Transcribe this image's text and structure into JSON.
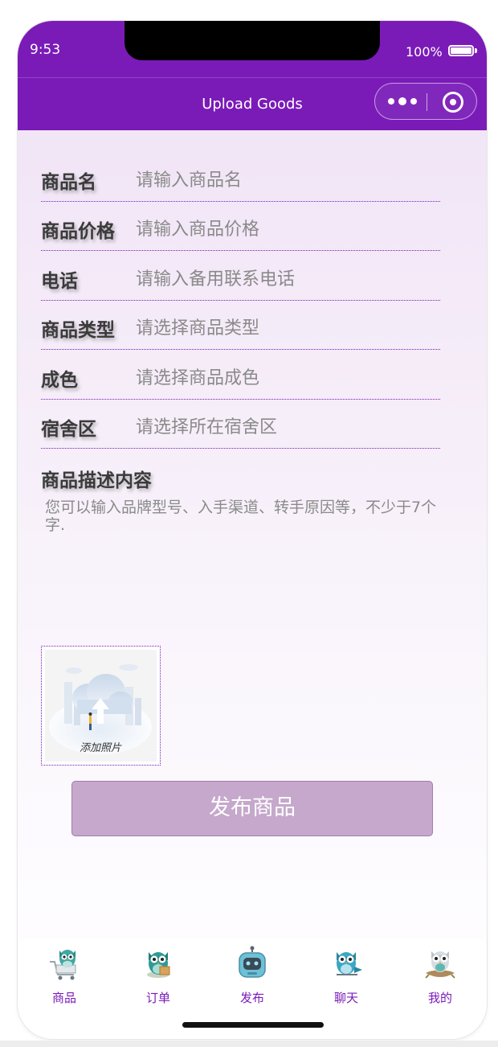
{
  "status_bar": {
    "time": "9:53",
    "battery_percent": "100%",
    "battery_level": 1.0
  },
  "nav_bar": {
    "title": "Upload Goods",
    "background_color": "#7a1bb8"
  },
  "form": {
    "fields": [
      {
        "label": "商品名",
        "placeholder": "请输入商品名",
        "value": ""
      },
      {
        "label": "商品价格",
        "placeholder": "请输入商品价格",
        "value": ""
      },
      {
        "label": "电话",
        "placeholder": "请输入备用联系电话",
        "value": ""
      },
      {
        "label": "商品类型",
        "placeholder": "请选择商品类型",
        "value": ""
      },
      {
        "label": "成色",
        "placeholder": "请选择商品成色",
        "value": ""
      },
      {
        "label": "宿舍区",
        "placeholder": "请选择所在宿舍区",
        "value": ""
      }
    ],
    "description": {
      "label": "商品描述内容",
      "placeholder": "您可以输入品牌型号、入手渠道、转手原因等，不少于7个字.",
      "value": ""
    },
    "photo_upload": {
      "caption": "添加照片",
      "icon": "cloud-upload-illustration"
    }
  },
  "publish_button": {
    "label": "发布商品",
    "color": "#c6a8cc"
  },
  "tab_bar": {
    "active_color": "#7a1bb8",
    "items": [
      {
        "label": "商品",
        "icon": "owl-cart-icon"
      },
      {
        "label": "订单",
        "icon": "owl-order-icon"
      },
      {
        "label": "发布",
        "icon": "robot-publish-icon"
      },
      {
        "label": "聊天",
        "icon": "owl-chat-icon"
      },
      {
        "label": "我的",
        "icon": "owl-nest-icon"
      }
    ]
  }
}
